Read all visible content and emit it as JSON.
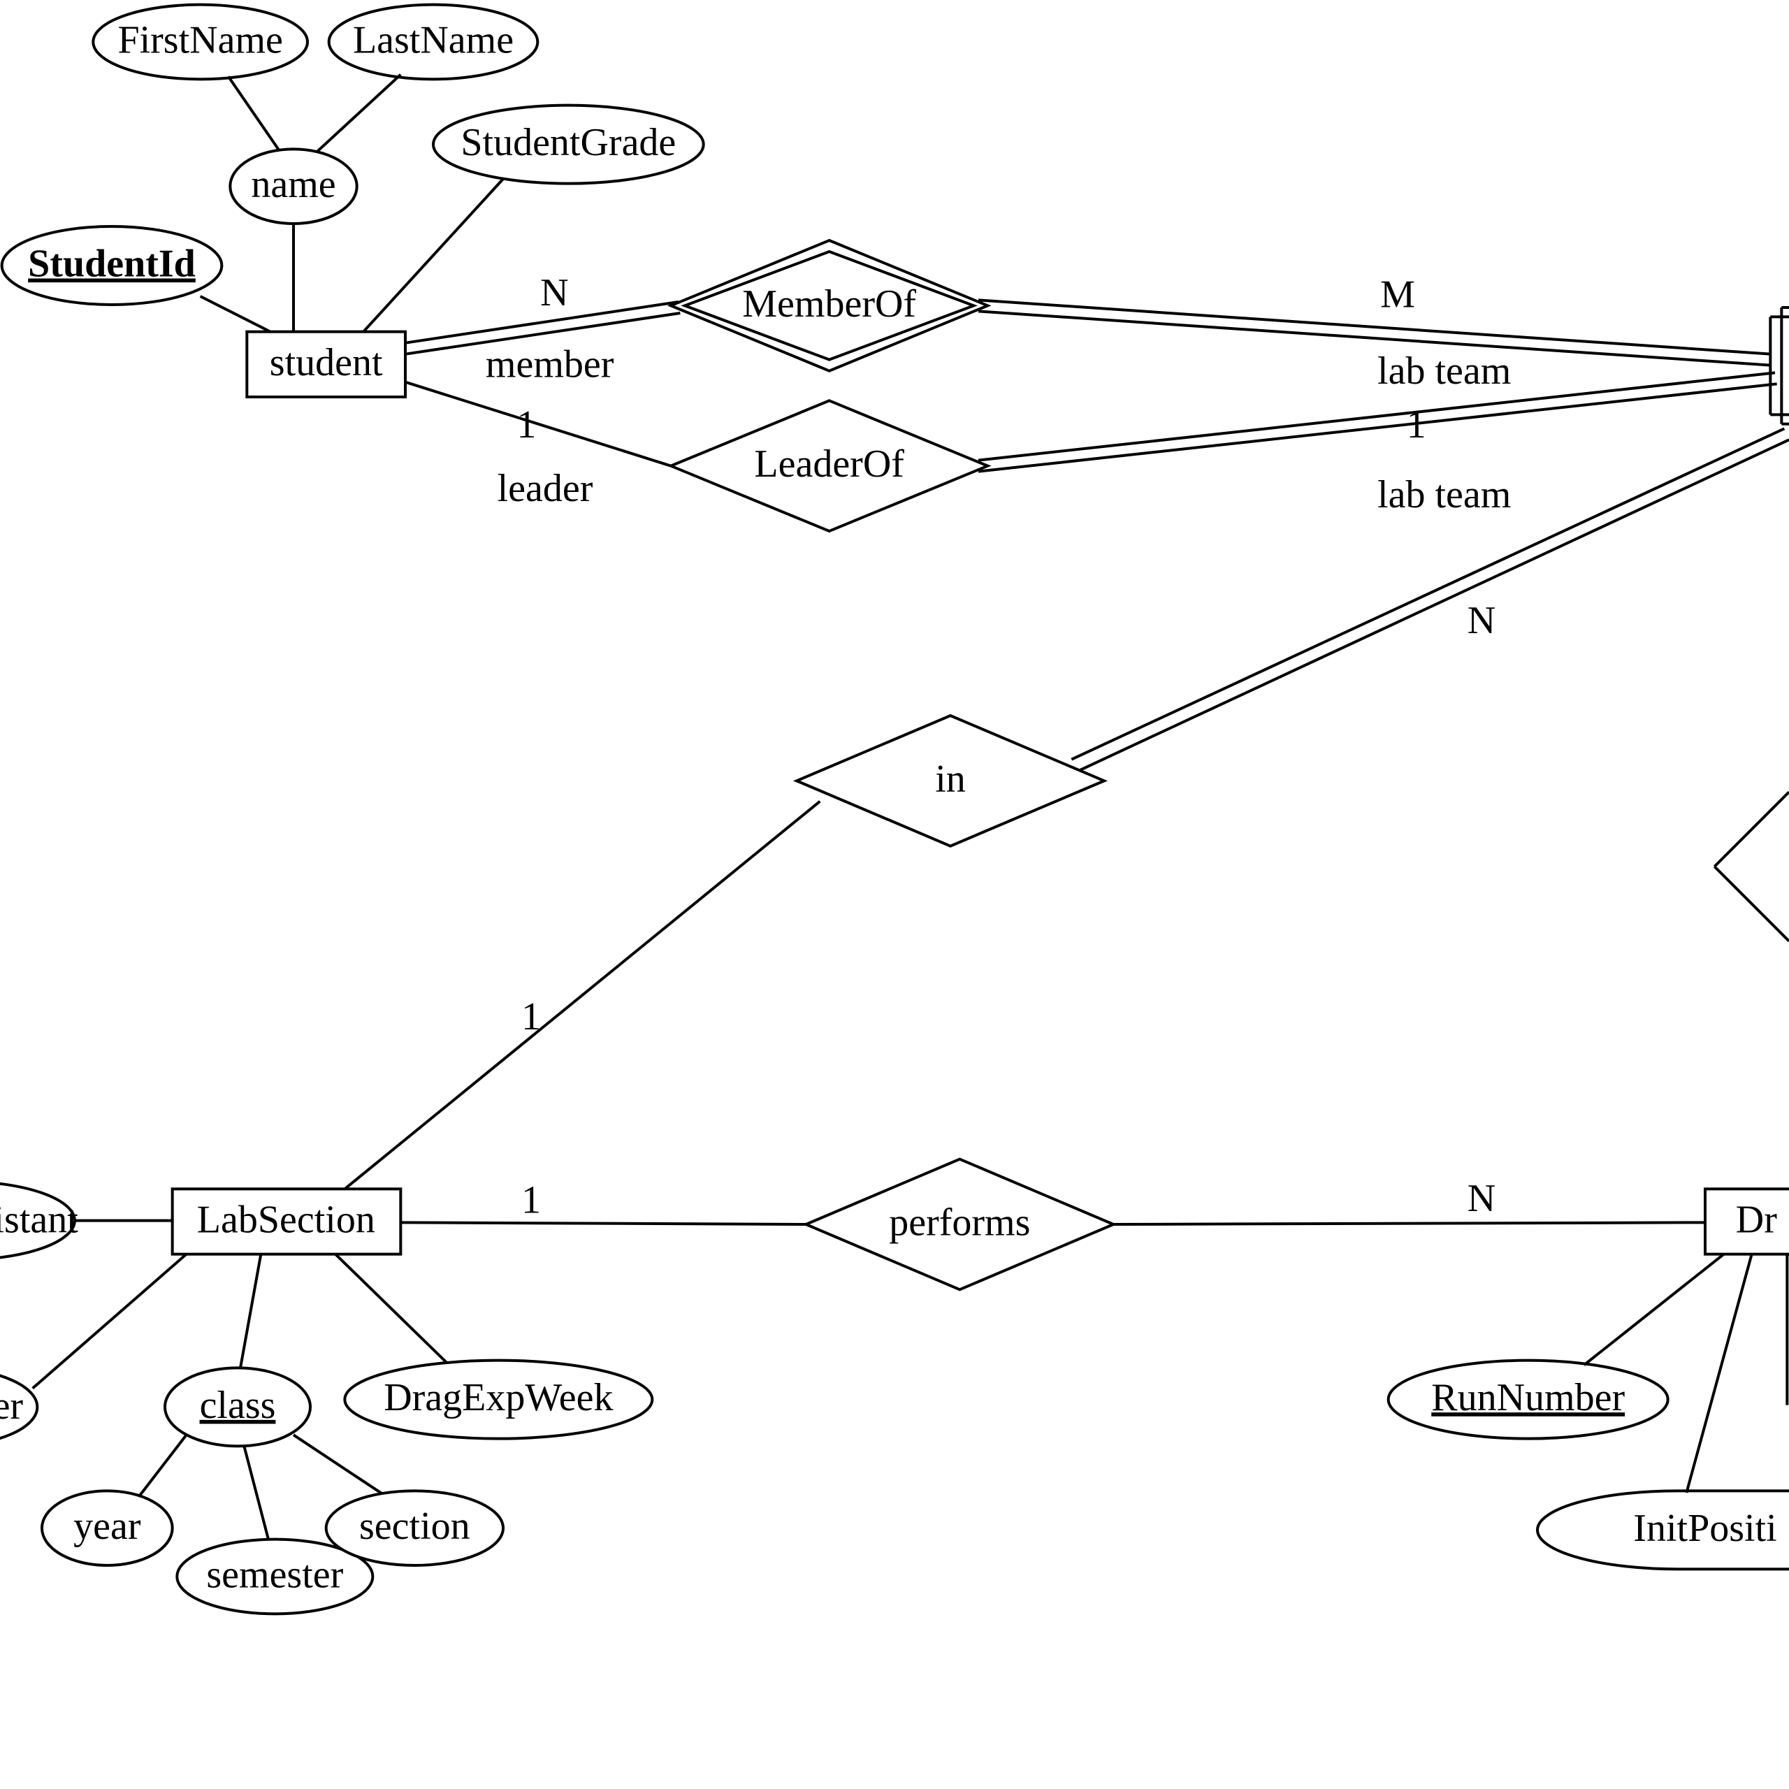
{
  "attributes": {
    "firstName": "FirstName",
    "lastName": "LastName",
    "name": "name",
    "studentId": "StudentId",
    "studentGrade": "StudentGrade",
    "assistant": "ssistant",
    "ber": "ber",
    "year": "year",
    "class": "class",
    "semester": "semester",
    "section": "section",
    "dragExpWeek": "DragExpWeek",
    "runNumber": "RunNumber",
    "initPosition": "InitPositi"
  },
  "entities": {
    "student": "student",
    "labSection": "LabSection",
    "dr": "Dr"
  },
  "relationships": {
    "memberOf": "MemberOf",
    "leaderOf": "LeaderOf",
    "in": "in",
    "performs": "performs"
  },
  "labels": {
    "N": "N",
    "M": "M",
    "one": "1",
    "member": "member",
    "leader": "leader",
    "labteam": "lab team"
  }
}
